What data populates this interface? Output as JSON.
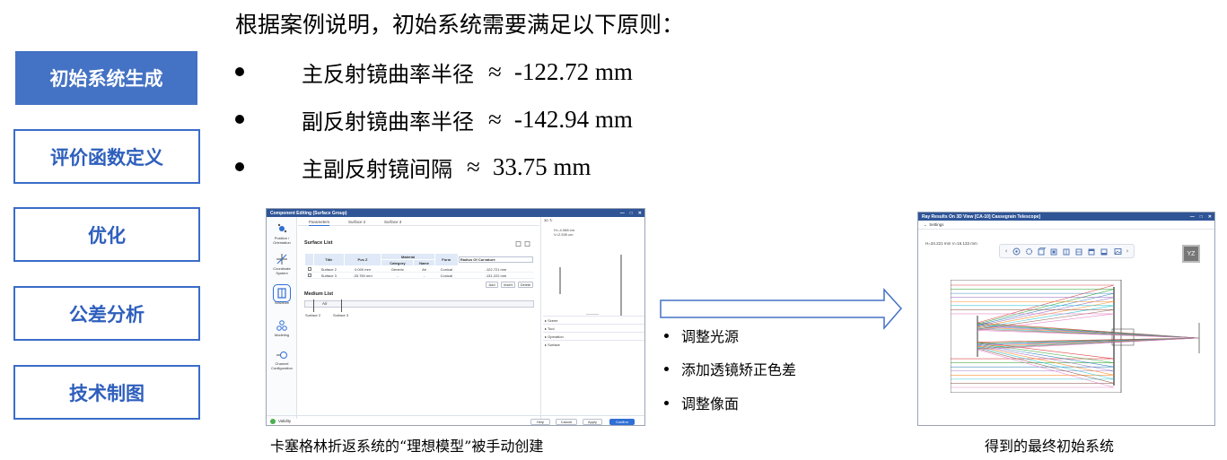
{
  "nav": {
    "items": [
      {
        "label": "初始系统生成",
        "active": true
      },
      {
        "label": "评价函数定义",
        "active": false
      },
      {
        "label": "优化",
        "active": false
      },
      {
        "label": "公差分析",
        "active": false
      },
      {
        "label": "技术制图",
        "active": false
      }
    ]
  },
  "heading": "根据案例说明，初始系统需要满足以下原则：",
  "bullets": [
    {
      "label": "主反射镜曲率半径",
      "approx": "≈",
      "value": "-122.72 mm"
    },
    {
      "label": "副反射镜曲率半径",
      "approx": "≈",
      "value": "-142.94 mm"
    },
    {
      "label": "主副反射镜间隔",
      "approx": "≈",
      "value": "33.75 mm"
    }
  ],
  "window1": {
    "title": "Component Editing (Surface Group)",
    "tabs": [
      "Parameters",
      "Surface 2",
      "Surface 3"
    ],
    "sidebar": [
      "Position / Orientation",
      "Coordinate System",
      "Structure",
      "Modeling",
      "Channel Configuration"
    ],
    "surface_list_title": "Surface List",
    "material_header": "Material",
    "columns": [
      "Title",
      "Pos Z",
      "Category",
      "Name",
      "Form",
      "Radius Of Curvature"
    ],
    "rows": [
      [
        "Surface 2",
        "0.000 mm",
        "Generic",
        "Air",
        "Conical",
        "-122.721 mm"
      ],
      [
        "Surface 3",
        "-33.750 mm",
        "-",
        "-",
        "Conical",
        "-131.222 mm"
      ]
    ],
    "table_buttons": [
      "Add",
      "Insert",
      "Delete"
    ],
    "medium_list_title": "Medium List",
    "medium_name": "Air",
    "surface_labels": [
      "Surface 2",
      "Surface 3"
    ],
    "view_label": "3D",
    "coord": [
      "H=-4.068 cm",
      "V=2.539 cm"
    ],
    "accordion": [
      "Scene",
      "Tool",
      "Operation",
      "Surface"
    ],
    "status": "Validity",
    "footer_buttons": [
      "Help",
      "Cancel",
      "Apply",
      "Confirm"
    ]
  },
  "caption1": "卡塞格林折返系统的“理想模型”被手动创建",
  "mid_list": [
    "调整光源",
    "添加透镜矫正色差",
    "调整像面"
  ],
  "window2": {
    "title": "Ray Results On 3D View [CA-10] Cassegrain Telescope]",
    "settings": "Settings",
    "coord": "H=34.221 mm V=16.133 mm",
    "yz_label": "YZ"
  },
  "caption2": "得到的最终初始系统",
  "colors": {
    "accent": "#4472c4",
    "titlebar": "#2f5597",
    "primary": "#2f6fd6"
  },
  "icons": {
    "toolbar": [
      "chevron-left-icon",
      "target-icon",
      "gear-icon",
      "cube-front-icon",
      "cube-back-icon",
      "cube-left-icon",
      "cube-right-icon",
      "cube-top-icon",
      "cube-bottom-icon",
      "image-icon",
      "chevron-right-icon"
    ]
  }
}
